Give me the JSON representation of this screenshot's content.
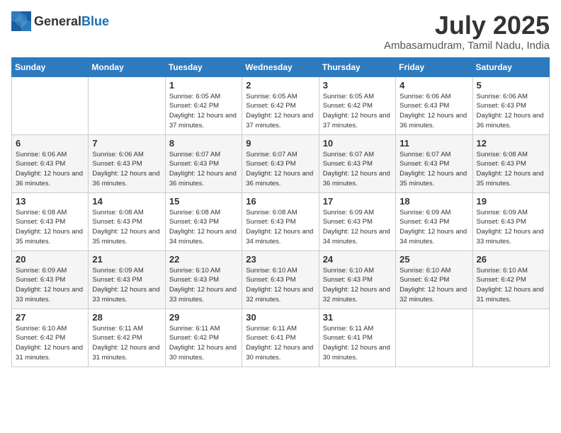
{
  "logo": {
    "text_general": "General",
    "text_blue": "Blue"
  },
  "header": {
    "month": "July 2025",
    "location": "Ambasamudram, Tamil Nadu, India"
  },
  "weekdays": [
    "Sunday",
    "Monday",
    "Tuesday",
    "Wednesday",
    "Thursday",
    "Friday",
    "Saturday"
  ],
  "weeks": [
    [
      {
        "day": "",
        "empty": true
      },
      {
        "day": "",
        "empty": true
      },
      {
        "day": "1",
        "sunrise": "6:05 AM",
        "sunset": "6:42 PM",
        "daylight": "12 hours and 37 minutes."
      },
      {
        "day": "2",
        "sunrise": "6:05 AM",
        "sunset": "6:42 PM",
        "daylight": "12 hours and 37 minutes."
      },
      {
        "day": "3",
        "sunrise": "6:05 AM",
        "sunset": "6:42 PM",
        "daylight": "12 hours and 37 minutes."
      },
      {
        "day": "4",
        "sunrise": "6:06 AM",
        "sunset": "6:43 PM",
        "daylight": "12 hours and 36 minutes."
      },
      {
        "day": "5",
        "sunrise": "6:06 AM",
        "sunset": "6:43 PM",
        "daylight": "12 hours and 36 minutes."
      }
    ],
    [
      {
        "day": "6",
        "sunrise": "6:06 AM",
        "sunset": "6:43 PM",
        "daylight": "12 hours and 36 minutes."
      },
      {
        "day": "7",
        "sunrise": "6:06 AM",
        "sunset": "6:43 PM",
        "daylight": "12 hours and 36 minutes."
      },
      {
        "day": "8",
        "sunrise": "6:07 AM",
        "sunset": "6:43 PM",
        "daylight": "12 hours and 36 minutes."
      },
      {
        "day": "9",
        "sunrise": "6:07 AM",
        "sunset": "6:43 PM",
        "daylight": "12 hours and 36 minutes."
      },
      {
        "day": "10",
        "sunrise": "6:07 AM",
        "sunset": "6:43 PM",
        "daylight": "12 hours and 36 minutes."
      },
      {
        "day": "11",
        "sunrise": "6:07 AM",
        "sunset": "6:43 PM",
        "daylight": "12 hours and 35 minutes."
      },
      {
        "day": "12",
        "sunrise": "6:08 AM",
        "sunset": "6:43 PM",
        "daylight": "12 hours and 35 minutes."
      }
    ],
    [
      {
        "day": "13",
        "sunrise": "6:08 AM",
        "sunset": "6:43 PM",
        "daylight": "12 hours and 35 minutes."
      },
      {
        "day": "14",
        "sunrise": "6:08 AM",
        "sunset": "6:43 PM",
        "daylight": "12 hours and 35 minutes."
      },
      {
        "day": "15",
        "sunrise": "6:08 AM",
        "sunset": "6:43 PM",
        "daylight": "12 hours and 34 minutes."
      },
      {
        "day": "16",
        "sunrise": "6:08 AM",
        "sunset": "6:43 PM",
        "daylight": "12 hours and 34 minutes."
      },
      {
        "day": "17",
        "sunrise": "6:09 AM",
        "sunset": "6:43 PM",
        "daylight": "12 hours and 34 minutes."
      },
      {
        "day": "18",
        "sunrise": "6:09 AM",
        "sunset": "6:43 PM",
        "daylight": "12 hours and 34 minutes."
      },
      {
        "day": "19",
        "sunrise": "6:09 AM",
        "sunset": "6:43 PM",
        "daylight": "12 hours and 33 minutes."
      }
    ],
    [
      {
        "day": "20",
        "sunrise": "6:09 AM",
        "sunset": "6:43 PM",
        "daylight": "12 hours and 33 minutes."
      },
      {
        "day": "21",
        "sunrise": "6:09 AM",
        "sunset": "6:43 PM",
        "daylight": "12 hours and 33 minutes."
      },
      {
        "day": "22",
        "sunrise": "6:10 AM",
        "sunset": "6:43 PM",
        "daylight": "12 hours and 33 minutes."
      },
      {
        "day": "23",
        "sunrise": "6:10 AM",
        "sunset": "6:43 PM",
        "daylight": "12 hours and 32 minutes."
      },
      {
        "day": "24",
        "sunrise": "6:10 AM",
        "sunset": "6:43 PM",
        "daylight": "12 hours and 32 minutes."
      },
      {
        "day": "25",
        "sunrise": "6:10 AM",
        "sunset": "6:42 PM",
        "daylight": "12 hours and 32 minutes."
      },
      {
        "day": "26",
        "sunrise": "6:10 AM",
        "sunset": "6:42 PM",
        "daylight": "12 hours and 31 minutes."
      }
    ],
    [
      {
        "day": "27",
        "sunrise": "6:10 AM",
        "sunset": "6:42 PM",
        "daylight": "12 hours and 31 minutes."
      },
      {
        "day": "28",
        "sunrise": "6:11 AM",
        "sunset": "6:42 PM",
        "daylight": "12 hours and 31 minutes."
      },
      {
        "day": "29",
        "sunrise": "6:11 AM",
        "sunset": "6:42 PM",
        "daylight": "12 hours and 30 minutes."
      },
      {
        "day": "30",
        "sunrise": "6:11 AM",
        "sunset": "6:41 PM",
        "daylight": "12 hours and 30 minutes."
      },
      {
        "day": "31",
        "sunrise": "6:11 AM",
        "sunset": "6:41 PM",
        "daylight": "12 hours and 30 minutes."
      },
      {
        "day": "",
        "empty": true
      },
      {
        "day": "",
        "empty": true
      }
    ]
  ]
}
